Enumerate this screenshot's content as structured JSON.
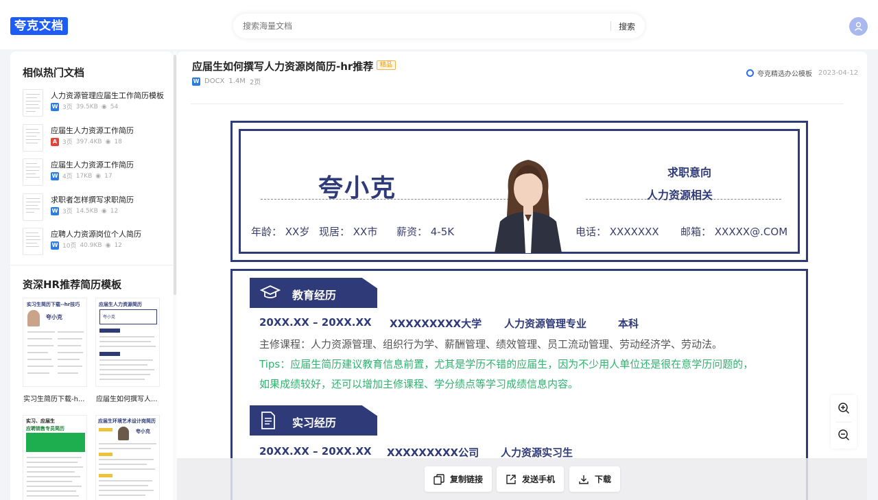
{
  "header": {
    "logo": "夸克文档",
    "search_placeholder": "搜索海量文档",
    "search_button": "搜索"
  },
  "sidebar": {
    "similar_title": "相似热门文档",
    "docs": [
      {
        "title": "人力资源管理应届生工作简历模板",
        "type": "word",
        "type_icon": "W",
        "pages": "3页",
        "size": "39.5KB",
        "views": "54"
      },
      {
        "title": "应届生人力资源工作简历",
        "type": "pdf",
        "type_icon": "A",
        "pages": "3页",
        "size": "397.4KB",
        "views": "18"
      },
      {
        "title": "应届生人力资源工作简历",
        "type": "word",
        "type_icon": "W",
        "pages": "4页",
        "size": "17KB",
        "views": "17"
      },
      {
        "title": "求职者怎样撰写求职简历",
        "type": "word",
        "type_icon": "W",
        "pages": "3页",
        "size": "14.5KB",
        "views": "12"
      },
      {
        "title": "应聘人力资源岗位个人简历",
        "type": "word",
        "type_icon": "W",
        "pages": "10页",
        "size": "40.9KB",
        "views": "12"
      }
    ],
    "hr_title": "资深HR推荐简历模板",
    "hr_templates": [
      {
        "name": "实习生简历下载-h...",
        "thumb_title": "实习生简历下载--hr技巧",
        "thumb_name": "夸小克"
      },
      {
        "name": "应届生如何撰写人...",
        "thumb_title": "应届生人力资源简历",
        "thumb_name": "夸小克"
      },
      {
        "name": "",
        "thumb_title": "实习、应届生",
        "thumb_subtitle": "应聘销售专员简历",
        "thumb_name": ""
      },
      {
        "name": "",
        "thumb_title": "应届生环境艺术设计岗简历",
        "thumb_name": "夸小克"
      }
    ]
  },
  "document": {
    "title": "应届生如何撰写人力资源岗简历-hr推荐",
    "badge": "精品",
    "type_icon": "W",
    "format": "DOCX",
    "size": "1.4M",
    "pages": "2页",
    "source": "夸克精选办公模板",
    "date": "2023-04-12"
  },
  "resume": {
    "name": "夸小克",
    "intent_label": "求职意向",
    "intent": "人力资源相关",
    "age": "年龄：  XX岁",
    "location": "现居：  XX市",
    "salary": "薪资：  4-5K",
    "phone": "电话：  XXXXXXX",
    "email": "邮箱：  XXXXX@.COM",
    "education": {
      "title": "教育经历",
      "period": "20XX.XX – 20XX.XX",
      "school": "XXXXXXXXX大学",
      "major": "人力资源管理专业",
      "degree": "本科",
      "courses": "主修课程：人力资源管理、组织行为学、薪酬管理、绩效管理、员工流动管理、劳动经济学、劳动法。",
      "tip1": "Tips：应届生简历建议教育信息前置，尤其是学历不错的应届生，因为不少用人单位还是很在意学历问题的，",
      "tip2": "如果成绩较好，还可以增加主修课程、学分绩点等学习成绩信息内容。"
    },
    "internship": {
      "title": "实习经历",
      "period": "20XX.XX – 20XX.XX",
      "company": "XXXXXXXXX公司",
      "role": "人力资源实习生"
    }
  },
  "actions": {
    "copy_link": "复制链接",
    "send_phone": "发送手机",
    "download": "下载"
  },
  "colors": {
    "brand": "#1e5df5",
    "resume_navy": "#2f3a78",
    "tip_green": "#2fb36f",
    "badge_orange": "#e89a12"
  }
}
